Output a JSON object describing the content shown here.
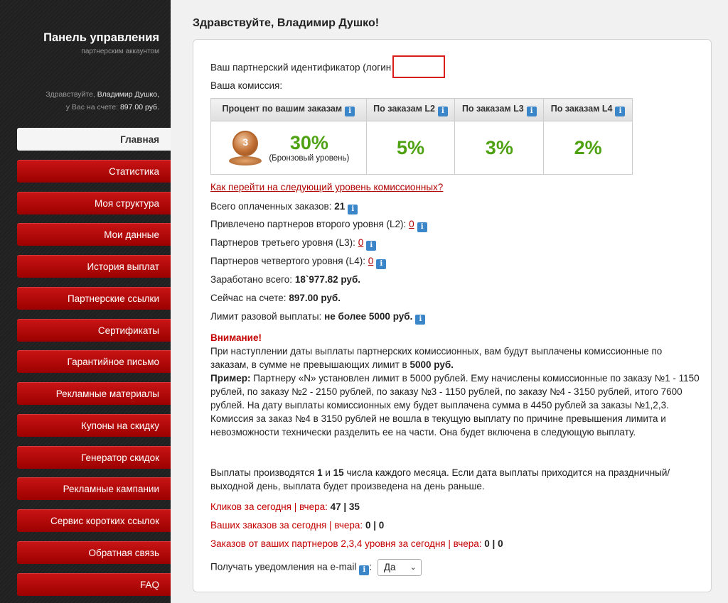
{
  "sidebar": {
    "title": "Панель управления",
    "subtitle": "партнерским аккаунтом",
    "hello": "Здравствуйте,",
    "user_name": "Владимир Душко,",
    "balance_prefix": "у Вас на счете:",
    "balance": "897.00 руб.",
    "nav": [
      {
        "label": "Главная"
      },
      {
        "label": "Статистика"
      },
      {
        "label": "Моя структура"
      },
      {
        "label": "Мои данные"
      },
      {
        "label": "История выплат"
      },
      {
        "label": "Партнерские ссылки"
      },
      {
        "label": "Сертификаты"
      },
      {
        "label": "Гарантийное письмо"
      },
      {
        "label": "Рекламные материалы"
      },
      {
        "label": "Купоны на скидку"
      },
      {
        "label": "Генератор скидок"
      },
      {
        "label": "Рекламные кампании"
      },
      {
        "label": "Сервис коротких ссылок"
      },
      {
        "label": "Обратная связь"
      },
      {
        "label": "FAQ"
      }
    ]
  },
  "main": {
    "greeting": "Здравствуйте, Владимир Душко!",
    "partner_id_label": "Ваш партнерский идентификатор (логин",
    "commission_label": "Ваша комиссия:",
    "table": {
      "headers": [
        "Процент по вашим заказам",
        "По заказам L2",
        "По заказам L3",
        "По заказам L4"
      ],
      "own_percent": "30%",
      "own_level": "(Бронзовый уровень)",
      "medal_number": "3",
      "l2": "5%",
      "l3": "3%",
      "l4": "2%"
    },
    "next_level_link": "Как перейти на следующий уровень комиссионных?",
    "stats": {
      "paid_orders_label": "Всего оплаченных заказов:",
      "paid_orders": "21",
      "l2_label": "Привлечено партнеров второго уровня (L2):",
      "l2_value": "0",
      "l3_label": "Партнеров третьего уровня (L3):",
      "l3_value": "0",
      "l4_label": "Партнеров четвертого уровня (L4):",
      "l4_value": "0",
      "earned_label": "Заработано всего:",
      "earned": "18`977.82 руб.",
      "balance_label": "Сейчас на счете:",
      "balance": "897.00 руб.",
      "limit_label": "Лимит разовой выплаты:",
      "limit": "не более 5000 руб."
    },
    "attention": {
      "title": "Внимание!",
      "text1": "При наступлении даты выплаты партнерских комиссионных, вам будут выплачены комиссионные по заказам, в сумме не превышающих лимит в",
      "text1_bold": "5000 руб.",
      "example_label": "Пример:",
      "example_text": "Партнеру «N» установлен лимит в 5000 рублей. Ему начислены комиссионные по заказу №1 - 1150 рублей, по заказу №2 - 2150 рублей, по заказу №3 - 1150 рублей, по заказу №4 - 3150 рублей, итого 7600 рублей. На дату выплаты комиссионных ему будет выплачена сумма в 4450 рублей за заказы №1,2,3. Комиссия за заказ №4 в 3150 рублей не вошла в текущую выплату по причине превышения лимита и невозможности технически разделить ее на части. Она будет включена в следующую выплату."
    },
    "payout": {
      "text_a": "Выплаты производятся",
      "day1": "1",
      "text_b": "и",
      "day2": "15",
      "text_c": "числа каждого месяца. Если дата выплаты приходится на праздничный/выходной день, выплата будет произведена на день раньше."
    },
    "clicks_label": "Кликов за сегодня | вчера:",
    "clicks_value": "47 | 35",
    "orders_label": "Ваших заказов за сегодня | вчера:",
    "orders_value": "0 | 0",
    "partner_orders_label": "Заказов от ваших партнеров 2,3,4 уровня за сегодня | вчера:",
    "partner_orders_value": "0 | 0",
    "notify_label": "Получать уведомления на e-mail",
    "notify_value": "Да"
  },
  "colors": {
    "nav_red": "#b40000",
    "percent_green": "#4ea211",
    "link_red": "#b00000",
    "info_blue": "#3b86c9"
  }
}
